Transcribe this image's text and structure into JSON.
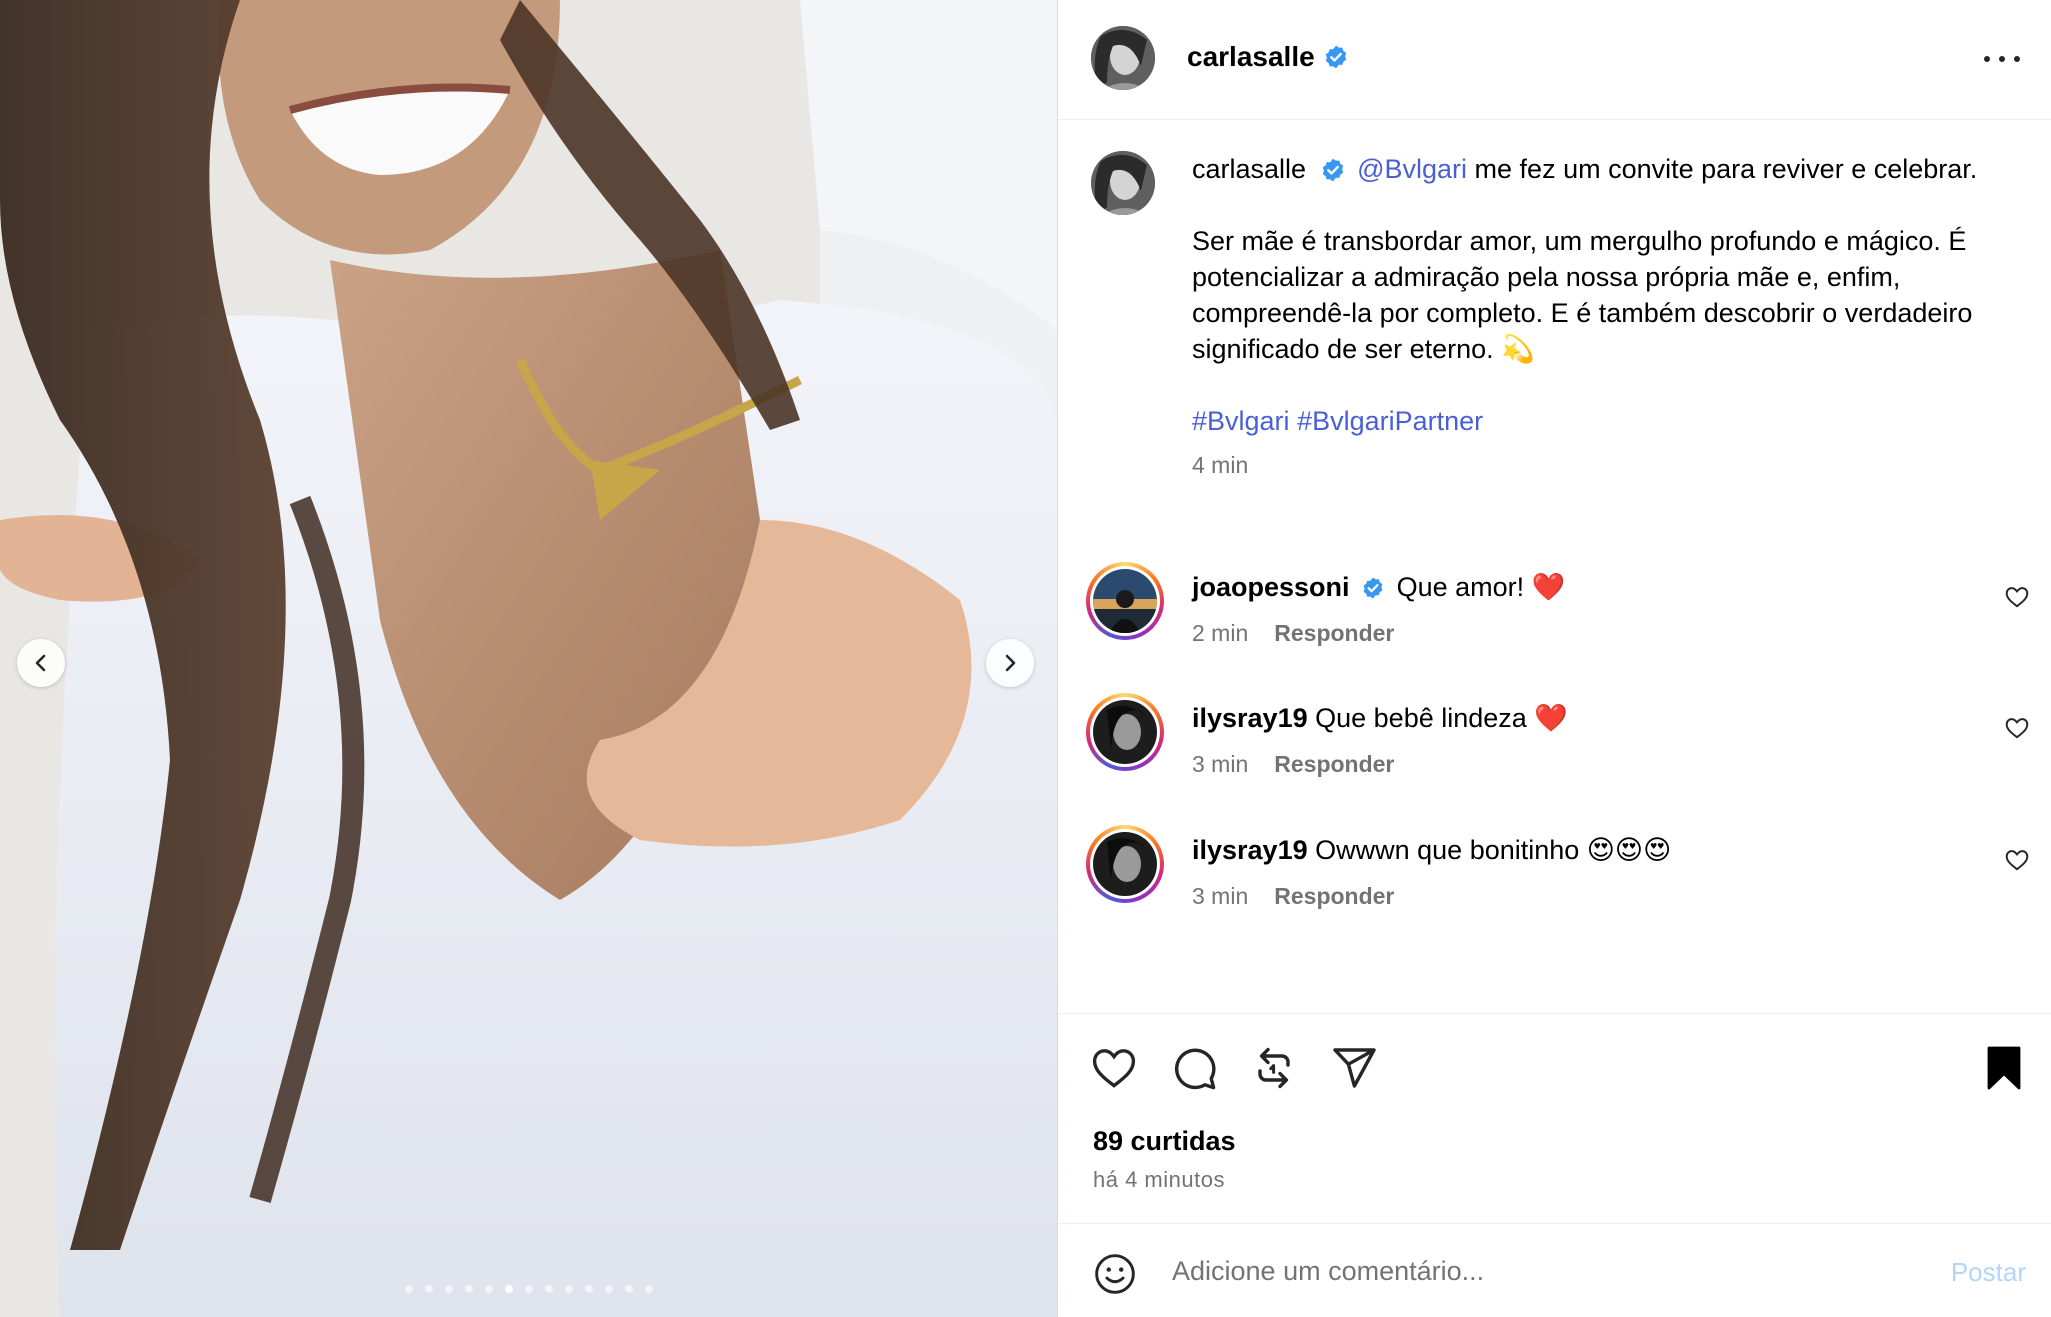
{
  "post": {
    "username": "carlasalle",
    "verified": true,
    "caption": {
      "mention": "@Bvlgari",
      "line1_rest": " me fez um convite para reviver e celebrar.",
      "paragraph2": "Ser mãe é transbordar amor, um mergulho profundo e mágico. É potencializar a admiração pela nossa própria mãe e, enfim, compreendê-la por completo. E é também descobrir o verdadeiro significado de ser eterno. 💫",
      "hashtags": [
        "#Bvlgari",
        "#BvlgariPartner"
      ],
      "time": "4 min"
    },
    "likes_label": "89 curtidas",
    "posted_label": "há 4 minutos"
  },
  "carousel": {
    "slide_count": 13,
    "active_index": 5
  },
  "comments": [
    {
      "username": "joaopessoni",
      "verified": true,
      "text": "Que amor! ❤️",
      "time": "2 min",
      "reply_label": "Responder"
    },
    {
      "username": "ilysray19",
      "verified": false,
      "text": "Que bebê lindeza ❤️",
      "time": "3 min",
      "reply_label": "Responder"
    },
    {
      "username": "ilysray19",
      "verified": false,
      "text": "Owwwn que bonitinho 😍😍😍",
      "time": "3 min",
      "reply_label": "Responder"
    }
  ],
  "add_comment": {
    "placeholder": "Adicione um comentário...",
    "post_label": "Postar"
  },
  "icons": {
    "like": "heart-icon",
    "comment": "comment-bubble-icon",
    "repost": "repost-icon",
    "share": "send-icon",
    "save": "bookmark-icon",
    "emoji": "smiley-icon",
    "more": "more-horizontal-icon"
  },
  "colors": {
    "link": "#4a5fd6",
    "verified": "#3897f0",
    "post_button_disabled": "#b3d4fc",
    "muted": "#737373"
  }
}
